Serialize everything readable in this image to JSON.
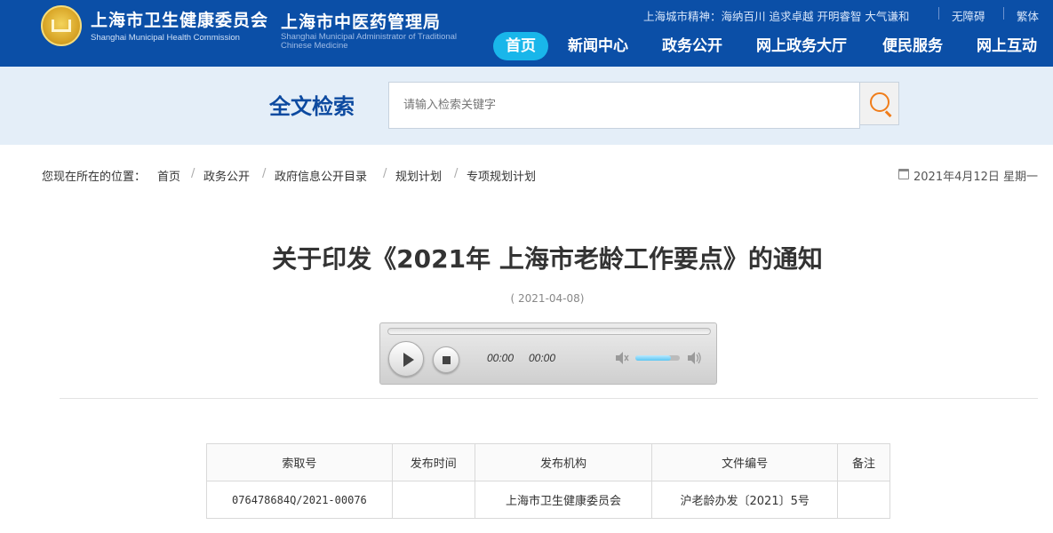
{
  "header": {
    "org1": "上海市卫生健康委员会",
    "org1_en": "Shanghai Municipal Health Commission",
    "org2": "上海市中医药管理局",
    "org2_en": "Shanghai Municipal Administrator of Traditional Chinese Medicine",
    "slogan": "上海城市精神：海纳百川 追求卓越 开明睿智 大气谦和",
    "accessibility": "无障碍",
    "traditional": "繁体",
    "nav": [
      "首页",
      "新闻中心",
      "政务公开",
      "网上政务大厅",
      "便民服务",
      "网上互动"
    ],
    "logo_icon": "city-emblem-icon",
    "colors": {
      "bar": "#0b4fa7",
      "active_tab": "#19b6ea"
    }
  },
  "search": {
    "title": "全文检索",
    "placeholder": "请输入检索关键字",
    "button_icon": "search-icon",
    "accent": "#f07d1a"
  },
  "breadcrumb": {
    "label": "您现在所在的位置：",
    "items": [
      "首页",
      "政务公开",
      "政府信息公开目录",
      "规划计划",
      "专项规划计划"
    ],
    "separator": "/",
    "date_icon": "calendar-icon",
    "today": "2021年4月12日 星期一"
  },
  "article": {
    "title": "关于印发《2021年 上海市老龄工作要点》的通知",
    "date": "( 2021-04-08)"
  },
  "player": {
    "current_time": "00:00",
    "duration": "00:00",
    "progress": 0,
    "volume": 0.8,
    "play_icon": "play-icon",
    "stop_icon": "stop-icon",
    "mute_icon": "volume-mute-icon",
    "max_icon": "volume-max-icon"
  },
  "meta_table": {
    "headers": [
      "索取号",
      "发布时间",
      "发布机构",
      "文件编号",
      "备注"
    ],
    "row": [
      "076478684Q/2021-00076",
      "",
      "上海市卫生健康委员会",
      "沪老龄办发〔2021〕5号",
      ""
    ]
  }
}
